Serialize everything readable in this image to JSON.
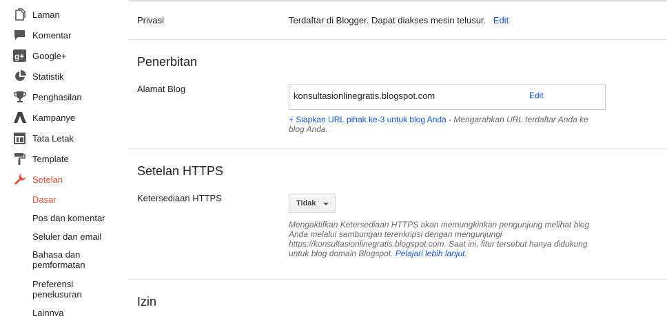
{
  "sidebar": {
    "items": [
      {
        "label": "Laman",
        "icon": "pages-icon"
      },
      {
        "label": "Komentar",
        "icon": "comment-icon"
      },
      {
        "label": "Google+",
        "icon": "google-plus-icon"
      },
      {
        "label": "Statistik",
        "icon": "stats-icon"
      },
      {
        "label": "Penghasilan",
        "icon": "trophy-icon"
      },
      {
        "label": "Kampanye",
        "icon": "campaign-icon"
      },
      {
        "label": "Tata Letak",
        "icon": "layout-icon"
      },
      {
        "label": "Template",
        "icon": "paint-roller-icon"
      },
      {
        "label": "Setelan",
        "icon": "wrench-icon"
      }
    ],
    "subitems": [
      "Dasar",
      "Pos dan komentar",
      "Seluler dan email",
      "Bahasa dan pemformatan",
      "Preferensi penelusuran",
      "Lainnya"
    ],
    "active_color": "#dd4b39"
  },
  "privacy": {
    "label": "Privasi",
    "value": "Terdaftar di Blogger. Dapat diakses mesin telusur.",
    "edit": "Edit"
  },
  "publishing": {
    "title": "Penerbitan",
    "address_label": "Alamat Blog",
    "address_value": "konsultasionlinegratis.blogspot.com",
    "edit": "Edit",
    "third_party_link": "+ Siapkan URL pihak ke-3 untuk blog Anda",
    "third_party_desc": " - Mengarahkan URL terdaftar Anda ke blog Anda."
  },
  "https": {
    "title": "Setelan HTTPS",
    "availability_label": "Ketersediaan HTTPS",
    "availability_value": "Tidak",
    "description": "Mengaktifkan Ketersediaan HTTPS akan memungkinkan pengunjung melihat blog Anda melalui sambungan terenkripsi dengan mengunjungi https://konsultasionlinegratis.blogspot.com. Saat ini, fitur tersebut hanya didukung untuk blog domain Blogspot. ",
    "learn_more": "Pelajari lebih lanjut",
    "learn_more_suffix": "."
  },
  "permissions": {
    "title": "Izin"
  },
  "colors": {
    "link": "#1155cc",
    "accent": "#dd4b39"
  }
}
